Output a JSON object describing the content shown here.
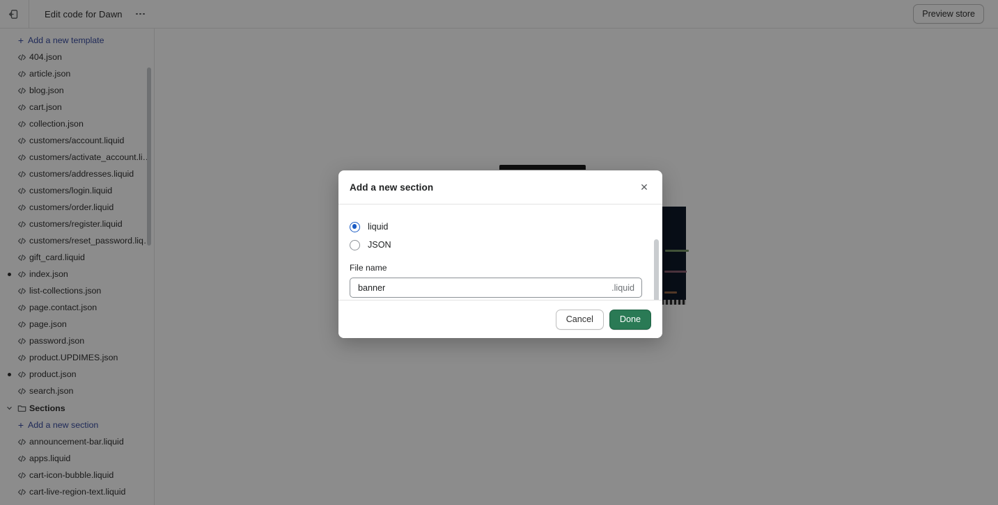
{
  "topbar": {
    "exit_icon": "exit-icon",
    "title": "Edit code for Dawn",
    "more_icon": "more-horizontal-icon",
    "preview_label": "Preview store"
  },
  "sidebar": {
    "add_template": {
      "label": "Add a new template",
      "icon": "plus-icon"
    },
    "templates": [
      {
        "name": "404.json",
        "icon": "code-file-icon",
        "modified": false
      },
      {
        "name": "article.json",
        "icon": "code-file-icon",
        "modified": false
      },
      {
        "name": "blog.json",
        "icon": "code-file-icon",
        "modified": false
      },
      {
        "name": "cart.json",
        "icon": "code-file-icon",
        "modified": false
      },
      {
        "name": "collection.json",
        "icon": "code-file-icon",
        "modified": false
      },
      {
        "name": "customers/account.liquid",
        "icon": "code-file-icon",
        "modified": false
      },
      {
        "name": "customers/activate_account.liq...",
        "icon": "code-file-icon",
        "modified": false
      },
      {
        "name": "customers/addresses.liquid",
        "icon": "code-file-icon",
        "modified": false
      },
      {
        "name": "customers/login.liquid",
        "icon": "code-file-icon",
        "modified": false
      },
      {
        "name": "customers/order.liquid",
        "icon": "code-file-icon",
        "modified": false
      },
      {
        "name": "customers/register.liquid",
        "icon": "code-file-icon",
        "modified": false
      },
      {
        "name": "customers/reset_password.liquid",
        "icon": "code-file-icon",
        "modified": false
      },
      {
        "name": "gift_card.liquid",
        "icon": "code-file-icon",
        "modified": false
      },
      {
        "name": "index.json",
        "icon": "code-file-icon",
        "modified": true
      },
      {
        "name": "list-collections.json",
        "icon": "code-file-icon",
        "modified": false
      },
      {
        "name": "page.contact.json",
        "icon": "code-file-icon",
        "modified": false
      },
      {
        "name": "page.json",
        "icon": "code-file-icon",
        "modified": false
      },
      {
        "name": "password.json",
        "icon": "code-file-icon",
        "modified": false
      },
      {
        "name": "product.UPDIMES.json",
        "icon": "code-file-icon",
        "modified": false
      },
      {
        "name": "product.json",
        "icon": "code-file-icon",
        "modified": true
      },
      {
        "name": "search.json",
        "icon": "code-file-icon",
        "modified": false
      }
    ],
    "sections_folder": {
      "label": "Sections",
      "icon": "folder-icon",
      "chevron": "chevron-down-icon",
      "expanded": true
    },
    "add_section": {
      "label": "Add a new section",
      "icon": "plus-icon"
    },
    "sections": [
      {
        "name": "announcement-bar.liquid",
        "icon": "code-file-icon",
        "modified": false
      },
      {
        "name": "apps.liquid",
        "icon": "code-file-icon",
        "modified": false
      },
      {
        "name": "cart-icon-bubble.liquid",
        "icon": "code-file-icon",
        "modified": false
      },
      {
        "name": "cart-live-region-text.liquid",
        "icon": "code-file-icon",
        "modified": false
      }
    ]
  },
  "modal": {
    "title": "Add a new section",
    "close_icon": "close-icon",
    "options": [
      {
        "label": "liquid",
        "selected": true
      },
      {
        "label": "JSON",
        "selected": false
      }
    ],
    "field_label": "File name",
    "field_value": "banner",
    "field_placeholder": "File name",
    "field_suffix": ".liquid",
    "cancel_label": "Cancel",
    "done_label": "Done"
  },
  "colors": {
    "accent_blue": "#1a5bc4",
    "link_blue": "#3a4ea1",
    "primary_green": "#2a7a55",
    "border": "#e3e3e3",
    "text": "#303030",
    "muted": "#6d7175",
    "editor_bg": "#0f1b2a"
  }
}
